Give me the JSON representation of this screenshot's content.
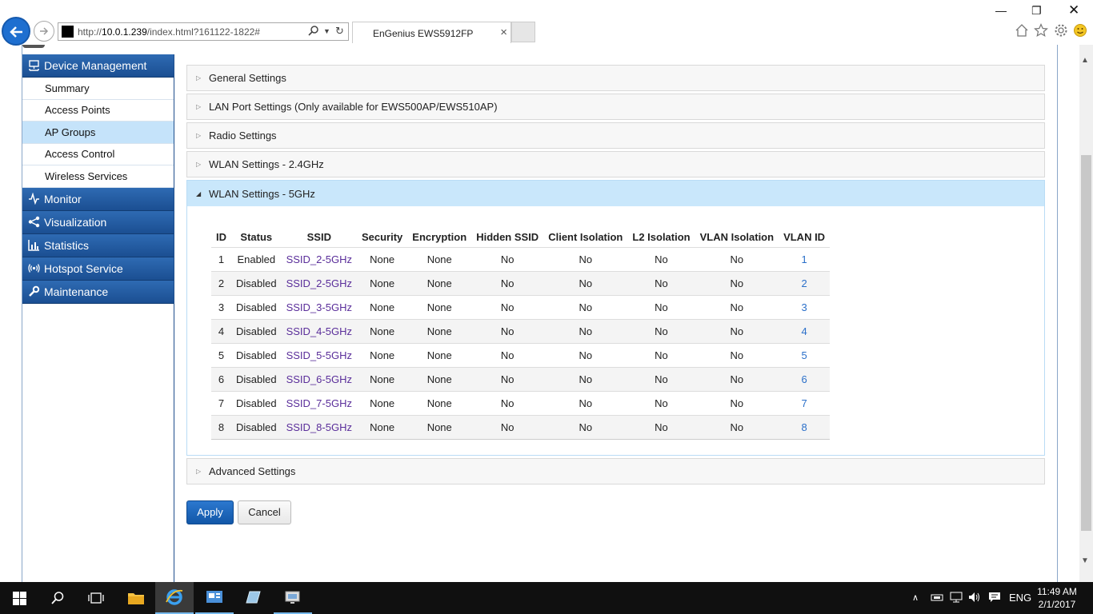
{
  "browser": {
    "url_prefix": "http://",
    "url_host": "10.0.1.239",
    "url_path": "/index.html?161122-1822#",
    "tab_title": "EnGenius EWS5912FP"
  },
  "sidebar": {
    "sections": [
      {
        "label": "Device Management",
        "icon": "network-icon"
      },
      {
        "label": "Monitor",
        "icon": "pulse-icon"
      },
      {
        "label": "Visualization",
        "icon": "share-icon"
      },
      {
        "label": "Statistics",
        "icon": "bar-chart-icon"
      },
      {
        "label": "Hotspot Service",
        "icon": "wifi-signal-icon"
      },
      {
        "label": "Maintenance",
        "icon": "wrench-icon"
      }
    ],
    "device_items": [
      "Summary",
      "Access Points",
      "AP Groups",
      "Access Control",
      "Wireless Services"
    ],
    "active_item": "AP Groups"
  },
  "panels": {
    "general": "General Settings",
    "lan": "LAN Port Settings (Only available for EWS500AP/EWS510AP)",
    "radio": "Radio Settings",
    "wlan24": "WLAN Settings - 2.4GHz",
    "wlan5": "WLAN Settings - 5GHz",
    "advanced": "Advanced Settings"
  },
  "table": {
    "headers": [
      "ID",
      "Status",
      "SSID",
      "Security",
      "Encryption",
      "Hidden SSID",
      "Client Isolation",
      "L2 Isolation",
      "VLAN Isolation",
      "VLAN ID"
    ],
    "rows": [
      [
        "1",
        "Enabled",
        "SSID_2-5GHz",
        "None",
        "None",
        "No",
        "No",
        "No",
        "No",
        "1"
      ],
      [
        "2",
        "Disabled",
        "SSID_2-5GHz",
        "None",
        "None",
        "No",
        "No",
        "No",
        "No",
        "2"
      ],
      [
        "3",
        "Disabled",
        "SSID_3-5GHz",
        "None",
        "None",
        "No",
        "No",
        "No",
        "No",
        "3"
      ],
      [
        "4",
        "Disabled",
        "SSID_4-5GHz",
        "None",
        "None",
        "No",
        "No",
        "No",
        "No",
        "4"
      ],
      [
        "5",
        "Disabled",
        "SSID_5-5GHz",
        "None",
        "None",
        "No",
        "No",
        "No",
        "No",
        "5"
      ],
      [
        "6",
        "Disabled",
        "SSID_6-5GHz",
        "None",
        "None",
        "No",
        "No",
        "No",
        "No",
        "6"
      ],
      [
        "7",
        "Disabled",
        "SSID_7-5GHz",
        "None",
        "None",
        "No",
        "No",
        "No",
        "No",
        "7"
      ],
      [
        "8",
        "Disabled",
        "SSID_8-5GHz",
        "None",
        "None",
        "No",
        "No",
        "No",
        "No",
        "8"
      ]
    ]
  },
  "buttons": {
    "apply": "Apply",
    "cancel": "Cancel"
  },
  "taskbar": {
    "lang": "ENG",
    "time": "11:49 AM",
    "date": "2/1/2017"
  },
  "colors": {
    "menu_blue": "#1b4f92",
    "active_item": "#c5e3fa",
    "ssid_link": "#5a2e9a",
    "vlan_link": "#2a6fc9"
  }
}
